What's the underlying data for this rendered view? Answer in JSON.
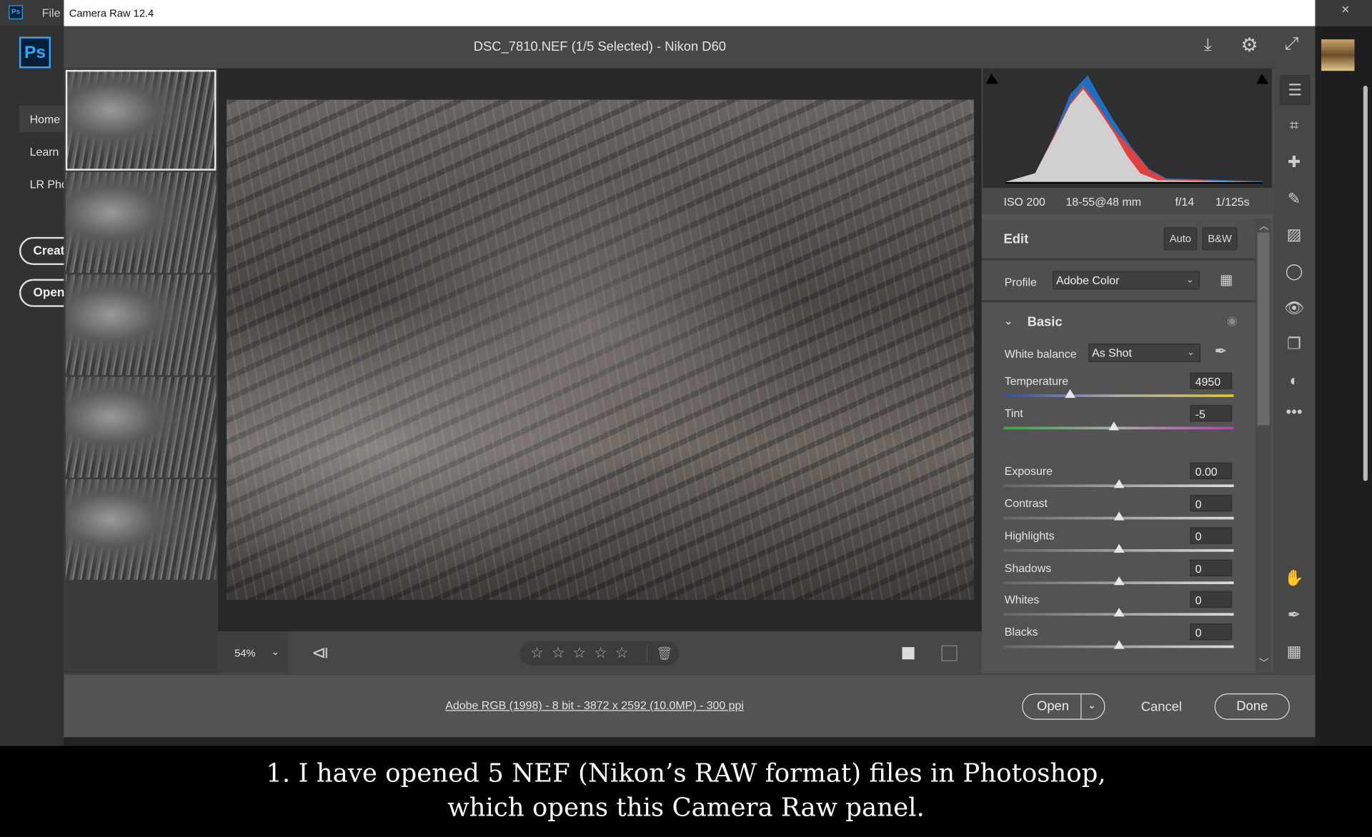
{
  "app": {
    "menu_file": "File",
    "dialog_title": "Camera Raw 12.4",
    "close": "×",
    "logo": "Ps"
  },
  "ps_sidebar": {
    "items": [
      {
        "label": "Home"
      },
      {
        "label": "Learn"
      },
      {
        "label": "LR Pho"
      }
    ],
    "create": "Creat",
    "open": "Open"
  },
  "header": {
    "title": "DSC_7810.NEF (1/5 Selected)  -  Nikon D60"
  },
  "filmstrip": {
    "count": 5,
    "selected": 1
  },
  "toolbar": {
    "zoom": "54%",
    "rating_stars": 5
  },
  "exif": {
    "iso": "ISO 200",
    "lens": "18-55@48 mm",
    "aperture": "f/14",
    "shutter": "1/125s"
  },
  "edit": {
    "title": "Edit",
    "auto": "Auto",
    "bw": "B&W",
    "profile_label": "Profile",
    "profile_value": "Adobe Color"
  },
  "basic": {
    "title": "Basic",
    "wb_label": "White balance",
    "wb_value": "As Shot",
    "sliders": [
      {
        "label": "Temperature",
        "value": "4950",
        "pos": 0.29
      },
      {
        "label": "Tint",
        "value": "-5",
        "pos": 0.48
      },
      {
        "label": "Exposure",
        "value": "0.00",
        "pos": 0.5
      },
      {
        "label": "Contrast",
        "value": "0",
        "pos": 0.5
      },
      {
        "label": "Highlights",
        "value": "0",
        "pos": 0.5
      },
      {
        "label": "Shadows",
        "value": "0",
        "pos": 0.5
      },
      {
        "label": "Whites",
        "value": "0",
        "pos": 0.5
      },
      {
        "label": "Blacks",
        "value": "0",
        "pos": 0.5
      }
    ]
  },
  "footer": {
    "info_link": "Adobe RGB (1998) - 8 bit - 3872 x 2592 (10.0MP) - 300 ppi",
    "open": "Open",
    "cancel": "Cancel",
    "done": "Done"
  },
  "caption": {
    "line1": "1. I have opened 5 NEF (Nikon’s RAW format) files in Photoshop,",
    "line2": "which opens this Camera Raw panel."
  },
  "colors": {
    "ps_blue": "#31a8ff",
    "panel": "#535353"
  }
}
